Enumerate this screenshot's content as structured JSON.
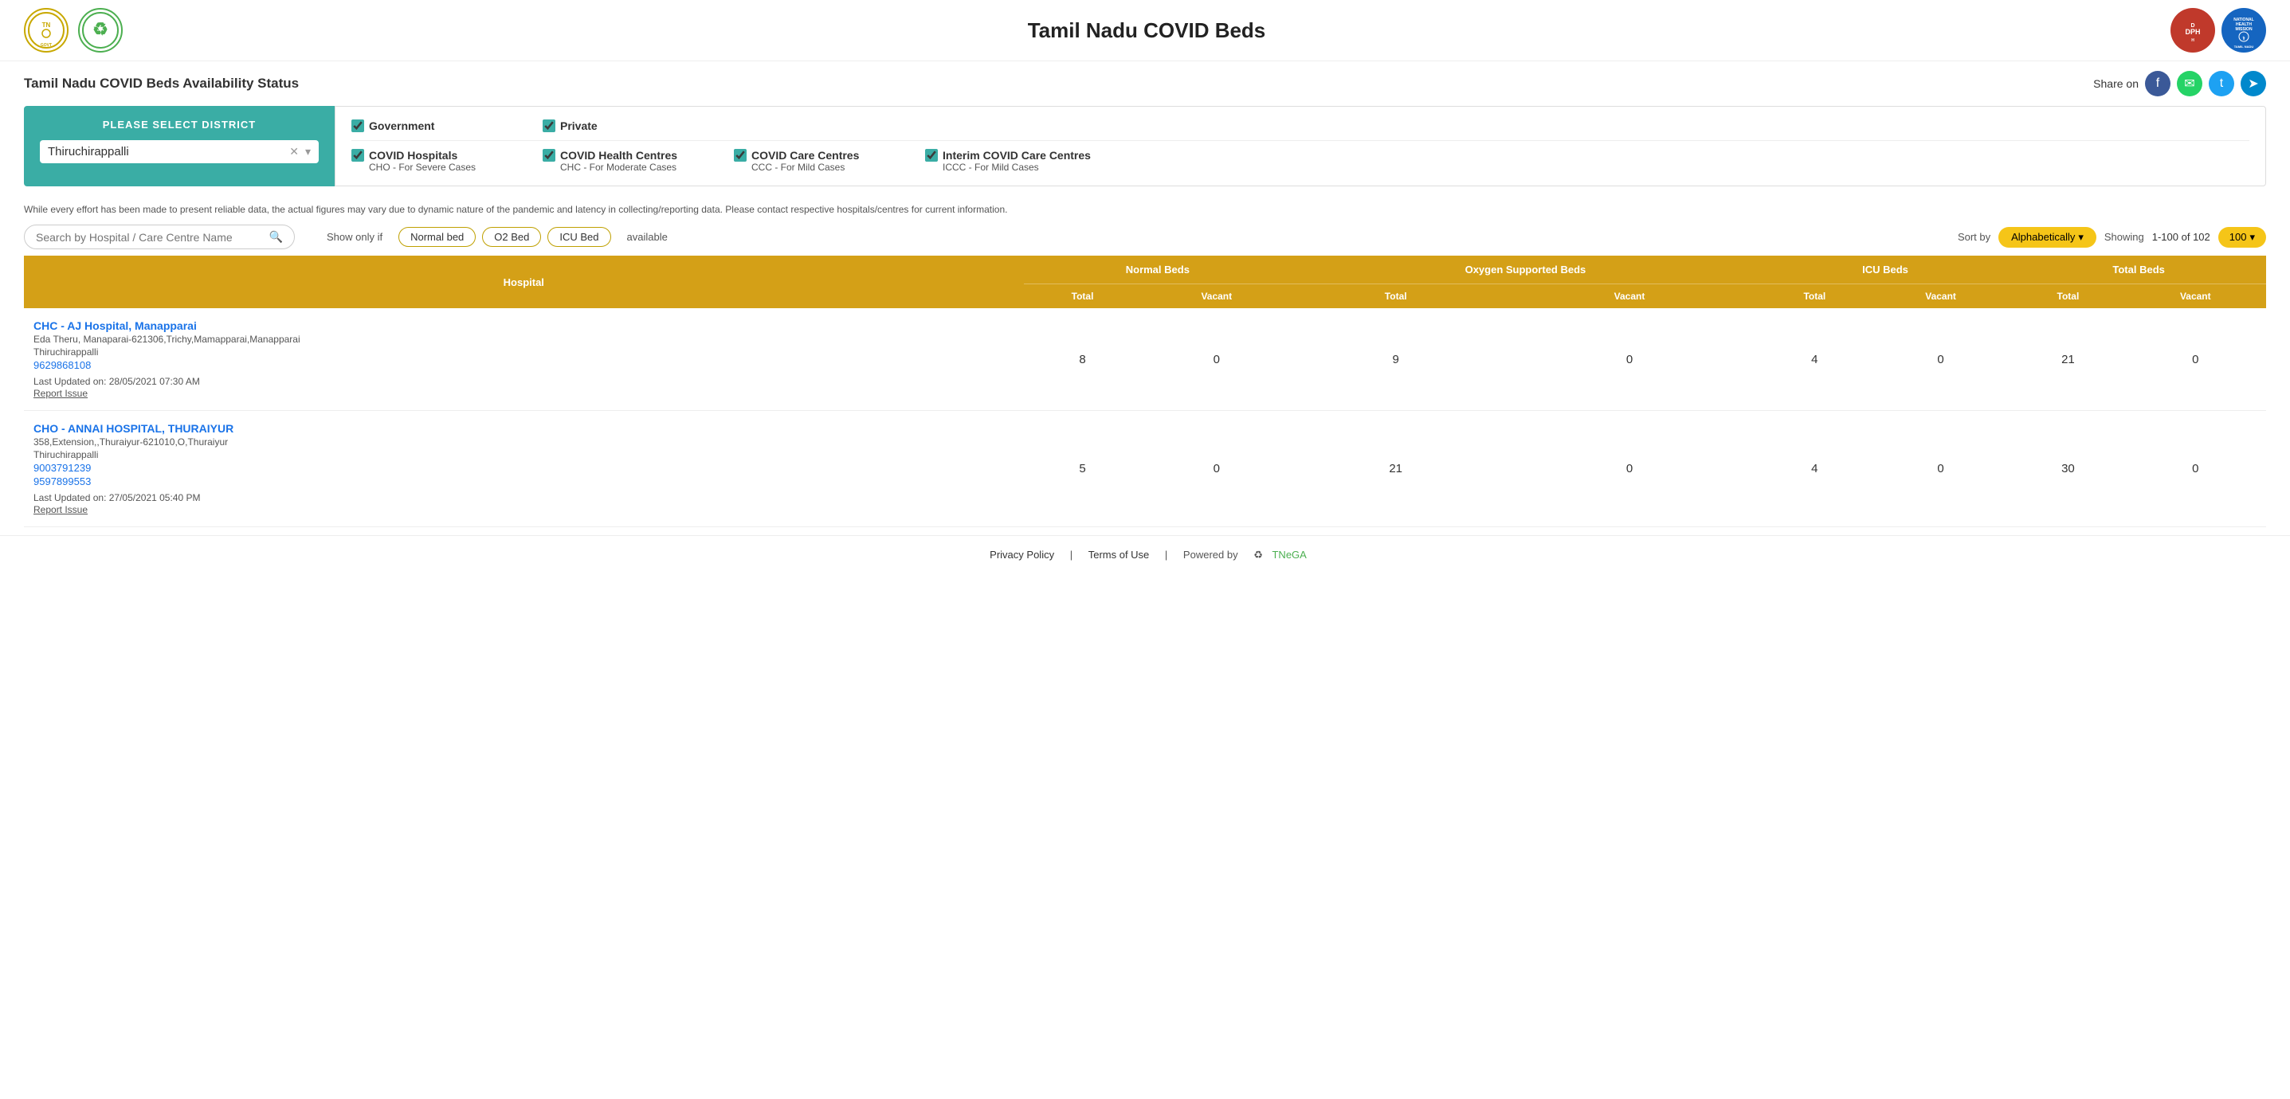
{
  "header": {
    "title": "Tamil Nadu COVID Beds",
    "logo_tn_text": "TN",
    "logo_green_symbol": "♻",
    "logo_dph_text": "DPH",
    "logo_nhm_text": "NATIONAL HEALTH MISSION"
  },
  "sub_header": {
    "title": "Tamil Nadu COVID Beds Availability Status",
    "share_label": "Share on"
  },
  "district_panel": {
    "title": "PLEASE SELECT DISTRICT",
    "selected": "Thiruchirappalli"
  },
  "checkboxes": {
    "government_label": "Government",
    "private_label": "Private",
    "covid_hospitals_label": "COVID Hospitals",
    "covid_hospitals_sub": "CHO - For Severe Cases",
    "covid_health_centres_label": "COVID Health Centres",
    "covid_health_centres_sub": "CHC - For Moderate Cases",
    "covid_care_centres_label": "COVID Care Centres",
    "covid_care_centres_sub": "CCC - For Mild Cases",
    "interim_covid_label": "Interim COVID Care Centres",
    "interim_covid_sub": "ICCC - For Mild Cases"
  },
  "disclaimer": "While every effort has been made to present reliable data, the actual figures may vary due to dynamic nature of the pandemic and latency in collecting/reporting data. Please contact respective hospitals/centres for current information.",
  "search": {
    "placeholder": "Search by Hospital / Care Centre Name"
  },
  "filters": {
    "show_only_label": "Show only if",
    "normal_bed_label": "Normal bed",
    "o2_bed_label": "O2 Bed",
    "icu_bed_label": "ICU Bed",
    "available_label": "available",
    "sort_label": "Sort by",
    "sort_value": "Alphabetically",
    "showing_label": "Showing",
    "showing_range": "1-100 of 102",
    "count_value": "100"
  },
  "table": {
    "headers": {
      "hospital": "Hospital",
      "normal_beds": "Normal Beds",
      "oxygen_beds": "Oxygen Supported Beds",
      "icu_beds": "ICU Beds",
      "total_beds": "Total Beds",
      "total": "Total",
      "vacant": "Vacant"
    },
    "rows": [
      {
        "name": "CHC - AJ Hospital, Manapparai",
        "address": "Eda Theru, Manaparai-621306,Trichy,Mamapparai,Manapparai",
        "district": "Thiruchirappalli",
        "phone1": "9629868108",
        "phone2": "",
        "last_updated": "Last Updated on: 28/05/2021 07:30 AM",
        "report_issue": "Report Issue",
        "normal_total": "8",
        "normal_vacant": "0",
        "o2_total": "9",
        "o2_vacant": "0",
        "icu_total": "4",
        "icu_vacant": "0",
        "total_total": "21",
        "total_vacant": "0"
      },
      {
        "name": "CHO - ANNAI HOSPITAL, THURAIYUR",
        "address": "358,Extension,,Thuraiyur-621010,O,Thuraiyur",
        "district": "Thiruchirappalli",
        "phone1": "9003791239",
        "phone2": "9597899553",
        "last_updated": "Last Updated on: 27/05/2021 05:40 PM",
        "report_issue": "Report Issue",
        "normal_total": "5",
        "normal_vacant": "0",
        "o2_total": "21",
        "o2_vacant": "0",
        "icu_total": "4",
        "icu_vacant": "0",
        "total_total": "30",
        "total_vacant": "0"
      }
    ]
  },
  "footer": {
    "privacy_policy": "Privacy Policy",
    "terms_of_use": "Terms of Use",
    "powered_by": "Powered by",
    "tnega": "TNeGA"
  }
}
